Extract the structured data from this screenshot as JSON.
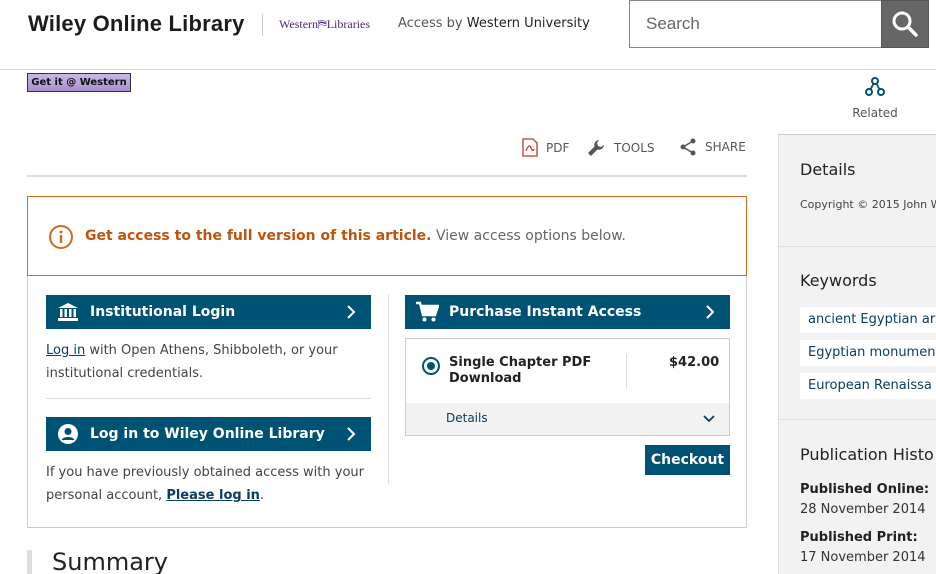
{
  "header": {
    "logo": "Wiley Online Library",
    "partner_logo": "Western⛿Libraries",
    "access_by_label": "Access by",
    "institution": "Western University",
    "search_placeholder": "Search"
  },
  "getit_label": "Get it @ Western",
  "related_tab": {
    "label": "Related"
  },
  "toolbar": {
    "pdf": "PDF",
    "tools": "TOOLS",
    "share": "SHARE"
  },
  "alert": {
    "strong": "Get access to the full version of this article.",
    "sub": "View access options below."
  },
  "access": {
    "institutional_login": "Institutional Login",
    "inst_link": "Log in",
    "inst_line1_rest": " with Open Athens, Shibboleth, or your",
    "inst_line2": "institutional credentials.",
    "wiley_login": "Log in to Wiley Online Library",
    "wiley_line1": "If you have previously obtained access with your",
    "wiley_line2_pre": "personal account, ",
    "wiley_link": "Please log in",
    "wiley_line2_post": ".",
    "purchase": "Purchase Instant Access",
    "product_name": "Single Chapter PDF Download",
    "product_price": "$42.00",
    "product_details": "Details",
    "checkout": "Checkout"
  },
  "summary_heading": "Summary",
  "sidebar": {
    "details_heading": "Details",
    "copyright": "Copyright © 2015 John W",
    "keywords_heading": "Keywords",
    "keywords": [
      "ancient Egyptian ar",
      "Egyptian monumen",
      "European Renaissa"
    ],
    "pub_history_heading": "Publication Histo",
    "published_online_label": "Published Online:",
    "published_online_value": "28 November 2014",
    "published_print_label": "Published Print:",
    "published_print_value": "17 November 2014"
  },
  "colors": {
    "primary": "#005274",
    "alert": "#c1530c",
    "partner": "#4f2683"
  }
}
